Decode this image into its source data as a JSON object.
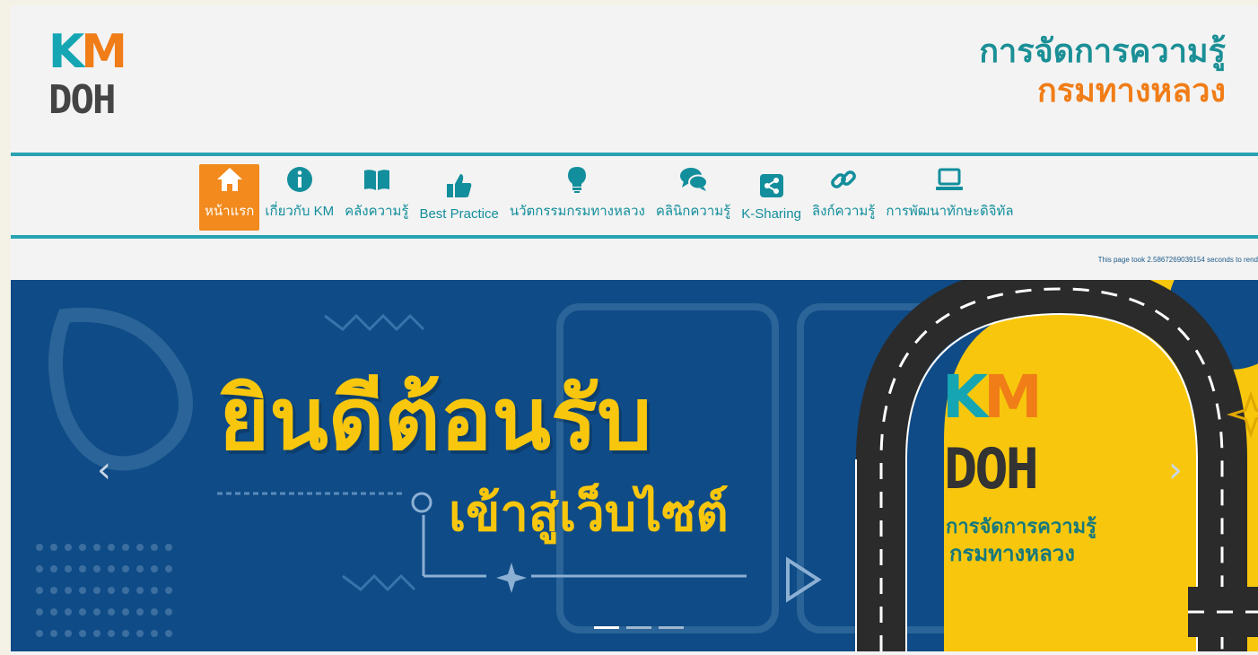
{
  "logo": {
    "k": "K",
    "m": "M",
    "doh": "DOH"
  },
  "site_title": {
    "line1": "การจัดการความรู้",
    "line2": "กรมทางหลวง"
  },
  "nav": {
    "items": [
      {
        "label": "หน้าแรก",
        "icon": "home-icon"
      },
      {
        "label": "เกี่ยวกับ KM",
        "icon": "info-icon"
      },
      {
        "label": "คลังความรู้",
        "icon": "book-icon"
      },
      {
        "label": "Best Practice",
        "icon": "thumbs-up-icon"
      },
      {
        "label": "นวัตกรรมกรมทางหลวง",
        "icon": "lightbulb-icon"
      },
      {
        "label": "คลินิกความรู้",
        "icon": "chat-icon"
      },
      {
        "label": "K-Sharing",
        "icon": "share-icon"
      },
      {
        "label": "ลิงก์ความรู้",
        "icon": "link-icon"
      },
      {
        "label": "การพัฒนาทักษะดิจิทัล",
        "icon": "laptop-icon"
      }
    ],
    "active_index": 0
  },
  "render_note": "This page took 2.586726903915​4 seconds to rend",
  "hero": {
    "headline": "ยินดีต้อนรับ",
    "subline": "เข้าสู่เว็บไซต์",
    "prev": "‹",
    "next": "›",
    "badge": {
      "k": "K",
      "m": "M",
      "doh": "DOH",
      "title1": "การจัดการความรู้",
      "title2": "กรมทางหลวง"
    },
    "slides": 3,
    "active_slide": 0
  },
  "colors": {
    "teal": "#16a6b3",
    "orange": "#f28a1d",
    "navy": "#0f4b86",
    "yellow": "#f8c70d"
  }
}
